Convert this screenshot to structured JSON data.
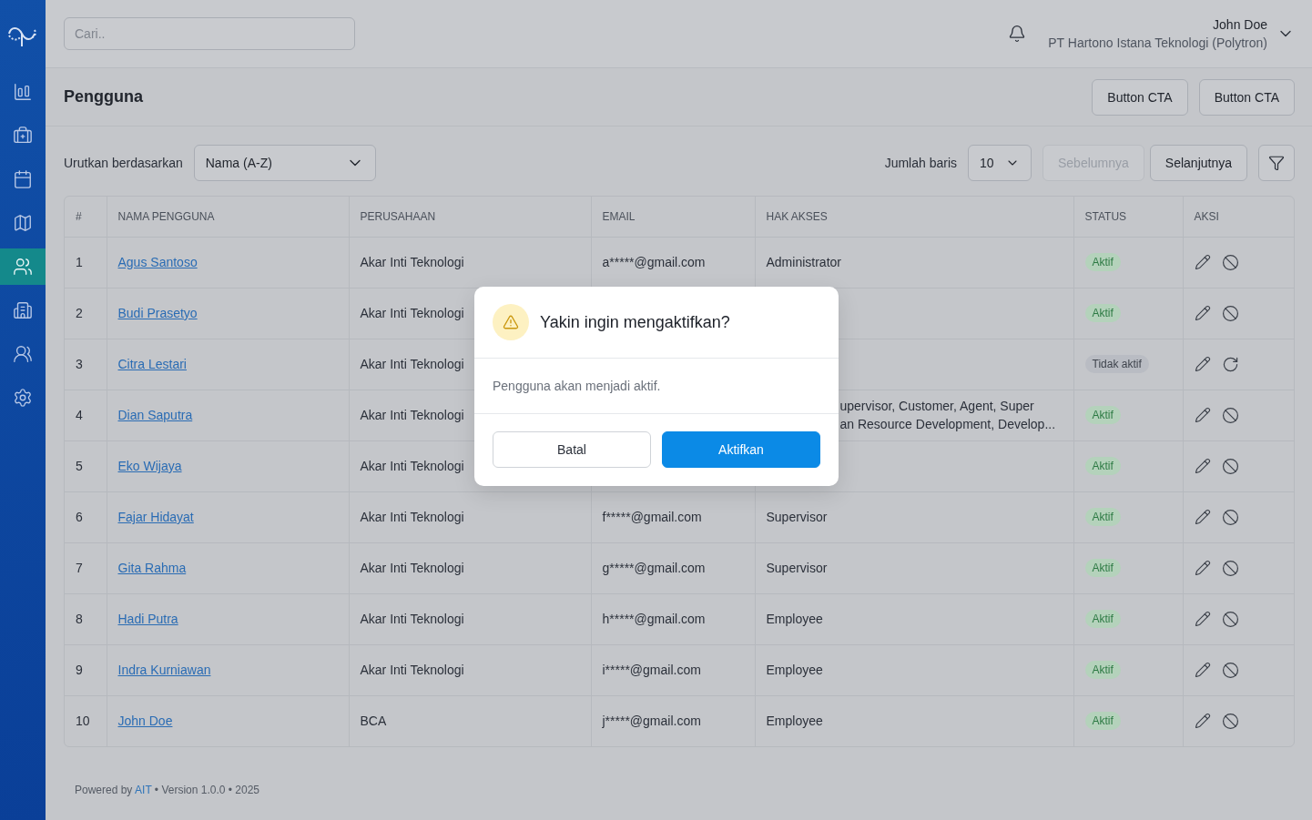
{
  "sidebar": {
    "items": [
      {
        "kind": "chart",
        "selected": false
      },
      {
        "kind": "briefcase",
        "selected": false
      },
      {
        "kind": "calendar",
        "selected": false
      },
      {
        "kind": "map",
        "selected": false
      },
      {
        "kind": "users",
        "selected": true
      },
      {
        "kind": "building",
        "selected": false
      },
      {
        "kind": "group",
        "selected": false
      },
      {
        "kind": "settings",
        "selected": false
      }
    ]
  },
  "search": {
    "placeholder": "Cari.."
  },
  "user": {
    "name": "John Doe",
    "company": "PT Hartono Istana Teknologi (Polytron)"
  },
  "page_title": "Pengguna",
  "header_buttons": [
    "Button CTA",
    "Button CTA"
  ],
  "sort": {
    "label": "Urutkan berdasarkan",
    "value": "Nama (A-Z)"
  },
  "rows_per_page": {
    "label": "Jumlah baris",
    "value": "10"
  },
  "pagination": [
    {
      "label": "Sebelumnya",
      "disabled": true
    },
    {
      "label": "Selanjutnya",
      "disabled": false
    }
  ],
  "table": {
    "columns": [
      "#",
      "NAMA PENGGUNA",
      "PERUSAHAAN",
      "EMAIL",
      "HAK AKSES",
      "STATUS",
      "AKSI"
    ],
    "rows": [
      {
        "no": "1",
        "name": "Agus Santoso",
        "company": "Akar Inti Teknologi",
        "email": "a*****@gmail.com",
        "access": "Administrator",
        "status": "Aktif",
        "active": true
      },
      {
        "no": "2",
        "name": "Budi Prasetyo",
        "company": "Akar Inti Teknologi",
        "status": "Aktif",
        "active": true
      },
      {
        "no": "3",
        "name": "Citra Lestari",
        "company": "Akar Inti Teknologi",
        "status": "Tidak aktif",
        "active": false
      },
      {
        "no": "4",
        "name": "Dian Saputra",
        "company": "Akar Inti Teknologi",
        "access": "upervisor, Customer, Agent, Super\nan Resource Development, Develop...",
        "access_covered": true,
        "status": "Aktif",
        "active": true
      },
      {
        "no": "5",
        "name": "Eko Wijaya",
        "company": "Akar Inti Teknologi",
        "status": "Aktif",
        "active": true
      },
      {
        "no": "6",
        "name": "Fajar Hidayat",
        "company": "Akar Inti Teknologi",
        "email": "f*****@gmail.com",
        "access": "Supervisor",
        "status": "Aktif",
        "active": true
      },
      {
        "no": "7",
        "name": "Gita Rahma",
        "company": "Akar Inti Teknologi",
        "email": "g*****@gmail.com",
        "access": "Supervisor",
        "status": "Aktif",
        "active": true
      },
      {
        "no": "8",
        "name": "Hadi Putra",
        "company": "Akar Inti Teknologi",
        "email": "h*****@gmail.com",
        "access": "Employee",
        "status": "Aktif",
        "active": true
      },
      {
        "no": "9",
        "name": "Indra Kurniawan",
        "company": "Akar Inti Teknologi",
        "email": "i*****@gmail.com",
        "access": "Employee",
        "status": "Aktif",
        "active": true
      },
      {
        "no": "10",
        "name": "John Doe",
        "company": "BCA",
        "email": "j*****@gmail.com",
        "access": "Employee",
        "status": "Aktif",
        "active": true
      }
    ]
  },
  "dialog": {
    "title": "Yakin ingin mengaktifkan?",
    "message": "Pengguna akan menjadi aktif.",
    "buttons": [
      {
        "label": "Batal",
        "kind": "secondary"
      },
      {
        "label": "Aktifkan",
        "kind": "primary"
      }
    ]
  },
  "footer": {
    "prefix": "Powered by",
    "link": "AIT",
    "suffix": "• Version 1.0.0 • 2025"
  }
}
